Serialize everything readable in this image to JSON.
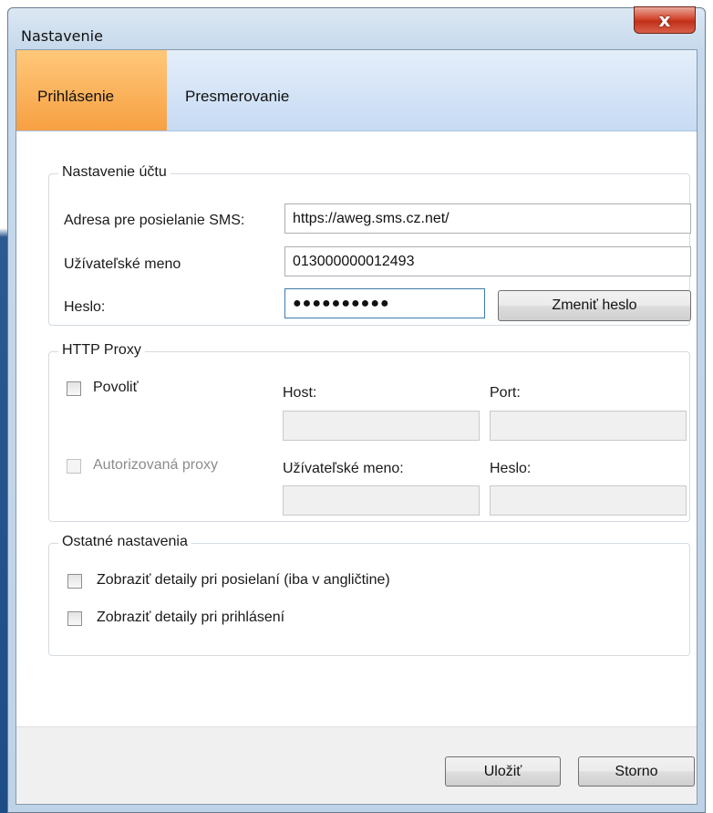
{
  "window": {
    "title": "Nastavenie",
    "close_glyph": "x"
  },
  "tabs": [
    {
      "label": "Prihlásenie",
      "active": true
    },
    {
      "label": "Presmerovanie",
      "active": false
    }
  ],
  "account": {
    "legend": "Nastavenie účtu",
    "sms_label": "Adresa pre posielanie SMS:",
    "sms_value": "https://aweg.sms.cz.net/",
    "user_label": "Užívateľské meno",
    "user_value": "013000000012493",
    "password_label": "Heslo:",
    "password_mask": "●●●●●●●●●●",
    "change_password_label": "Zmeniť heslo"
  },
  "proxy": {
    "legend": "HTTP Proxy",
    "enable_label": "Povoliť",
    "enable_checked": false,
    "host_label": "Host:",
    "host_value": "",
    "port_label": "Port:",
    "port_value": "",
    "auth_label": "Autorizovaná proxy",
    "auth_checked": false,
    "user_label": "Užívateľské meno:",
    "user_value": "",
    "password_label": "Heslo:",
    "password_value": ""
  },
  "other": {
    "legend": "Ostatné nastavenia",
    "details_send_label": "Zobraziť detaily pri posielaní (iba v angličtine)",
    "details_send_checked": false,
    "details_login_label": "Zobraziť detaily pri prihlásení",
    "details_login_checked": false
  },
  "footer": {
    "save_label": "Uložiť",
    "cancel_label": "Storno"
  },
  "colors": {
    "active_tab": "#f7a042",
    "tab_strip": "#c7dbf4",
    "window_frame": "#c6d9ec",
    "close_button": "#d3472f"
  },
  "icons": {
    "close": "close-icon",
    "checkbox": "checkbox-icon"
  }
}
